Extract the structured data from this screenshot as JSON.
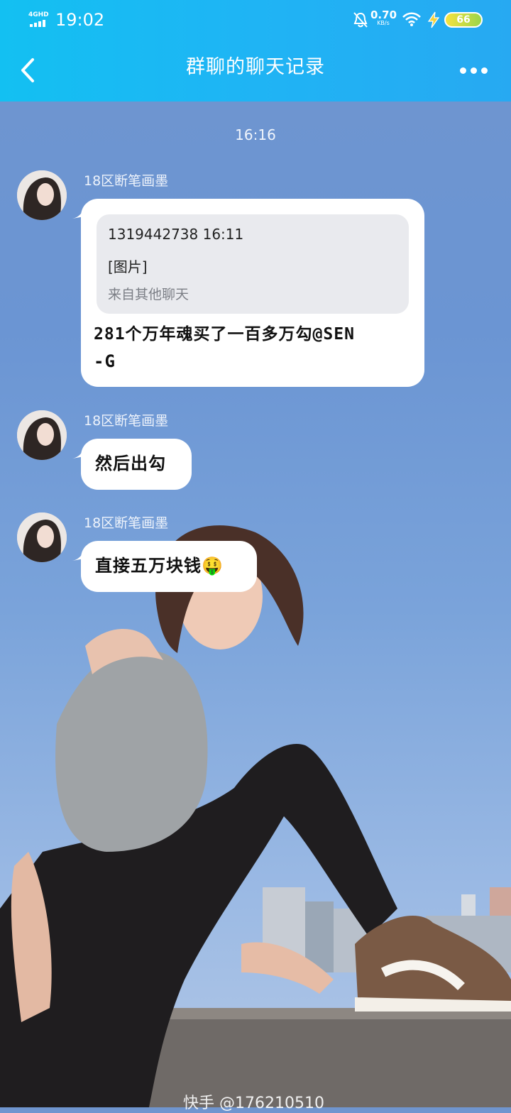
{
  "status_bar": {
    "network": "4GHD",
    "time": "19:02",
    "speed_value": "0.70",
    "speed_unit": "KB/s",
    "battery": "66"
  },
  "header": {
    "title": "群聊的聊天记录",
    "back_icon": "chevron-left-icon",
    "more_icon": "more-dots-icon"
  },
  "chat": {
    "timestamp": "16:16",
    "messages": [
      {
        "sender": "18区断笔画墨",
        "quote": {
          "line1": "1319442738 16:11",
          "line2": "[图片]",
          "line3": "来自其他聊天"
        },
        "text_line1": "281个万年魂买了一百多万勾@SEN",
        "text_line2": "-G"
      },
      {
        "sender": "18区断笔画墨",
        "text": "然后出勾"
      },
      {
        "sender": "18区断笔画墨",
        "text": "直接五万块钱",
        "emoji": "🤑"
      }
    ]
  },
  "watermark": "快手 @176210510"
}
